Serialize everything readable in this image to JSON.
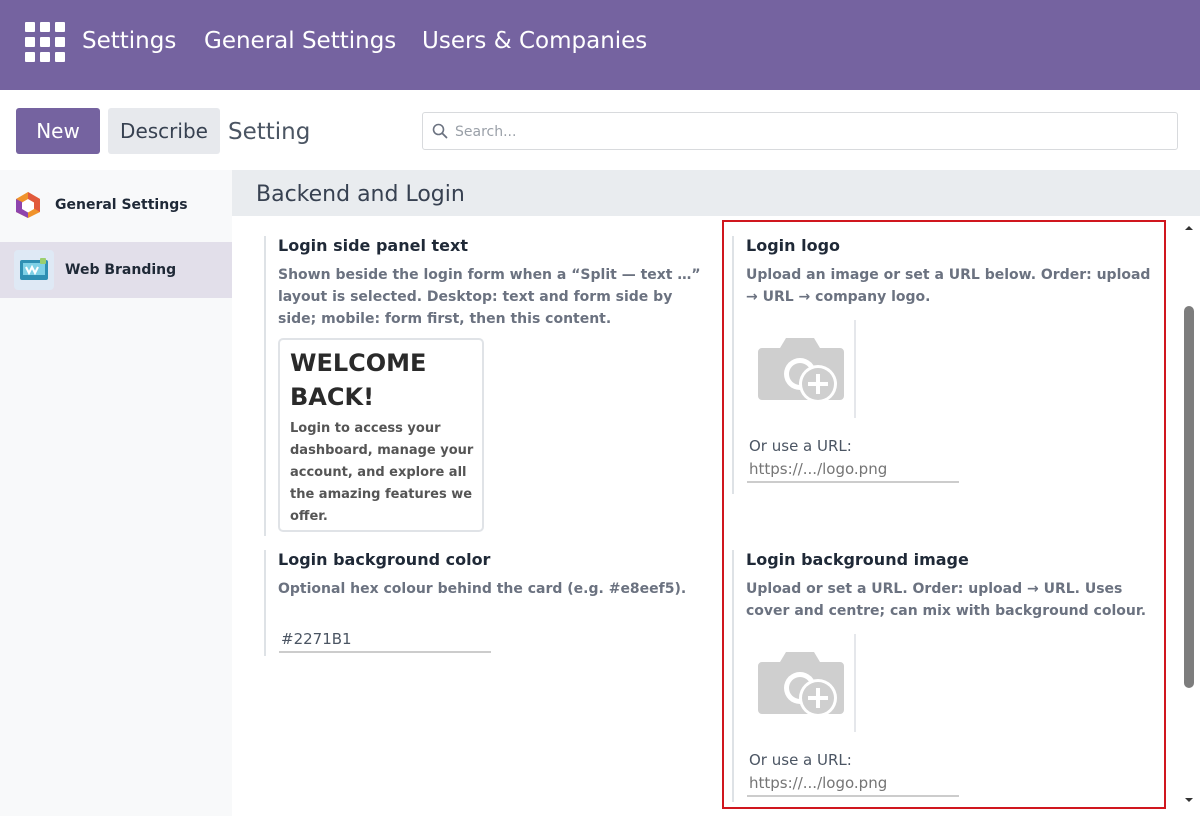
{
  "navbar": {
    "items": [
      "Settings",
      "General Settings",
      "Users & Companies"
    ],
    "background": "#7563a0"
  },
  "control_panel": {
    "new_label": "New",
    "describe_label": "Describe",
    "title": "Setting",
    "search_placeholder": "Search..."
  },
  "sidebar": {
    "items": [
      {
        "label": "General Settings",
        "icon": "general-settings-app-icon",
        "active": false
      },
      {
        "label": "Web Branding",
        "icon": "web-branding-app-icon",
        "active": true
      }
    ]
  },
  "section": {
    "title": "Backend and Login"
  },
  "settings": {
    "side_panel": {
      "title": "Login side panel text",
      "description": "Shown beside the login form when a “Split — text …” layout is selected. Desktop: text and form side by side; mobile: form first, then this content.",
      "card_title": "WELCOME BACK!",
      "card_body": "Login to access your dashboard, manage your account, and explore all the amazing features we offer."
    },
    "bg_color": {
      "title": "Login background color",
      "description": "Optional hex colour behind the card (e.g. #e8eef5).",
      "value": "#2271B1"
    },
    "logo": {
      "title": "Login logo",
      "description": "Upload an image or set a URL below. Order: upload → URL → company logo.",
      "url_label": "Or use a URL:",
      "url_placeholder": "https://.../logo.png",
      "image_icon": "camera-add-icon"
    },
    "bg_image": {
      "title": "Login background image",
      "description": "Upload or set a URL. Order: upload → URL. Uses cover and centre; can mix with background colour.",
      "url_label": "Or use a URL:",
      "url_placeholder": "https://.../logo.png",
      "image_icon": "camera-add-icon"
    }
  },
  "colors": {
    "accent": "#7563a0",
    "highlight_border": "#d0161e"
  }
}
